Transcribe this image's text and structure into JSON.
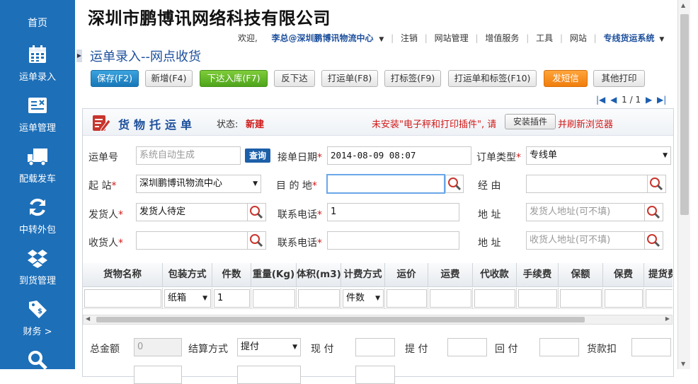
{
  "sidebar": {
    "home": "首页",
    "items": [
      {
        "label": "运单录入",
        "icon": "calendar-icon"
      },
      {
        "label": "运单管理",
        "icon": "ledger-icon"
      },
      {
        "label": "配载发车",
        "icon": "truck-icon"
      },
      {
        "label": "中转外包",
        "icon": "refresh-icon"
      },
      {
        "label": "到货管理",
        "icon": "dropbox-icon"
      },
      {
        "label": "财务 >",
        "icon": "tag-icon"
      },
      {
        "label": "",
        "icon": "search-icon"
      }
    ]
  },
  "header": {
    "company": "深圳市鹏博讯网络科技有限公司",
    "nav": {
      "welcome": "欢迎,",
      "user": "李总@深圳鹏博讯物流中心",
      "logout": "注销",
      "site_admin": "网站管理",
      "value_added": "增值服务",
      "tools": "工具",
      "website": "网站",
      "system": "专线货运系统"
    }
  },
  "page": {
    "title": "运单录入--网点收货"
  },
  "toolbar": {
    "save": "保存(F2)",
    "add": "新增(F4)",
    "stock_in": "下达入库(F7)",
    "revoke": "反下达",
    "print_waybill": "打运单(F8)",
    "print_label": "打标签(F9)",
    "print_both": "打运单和标签(F10)",
    "sms": "发短信",
    "other_print": "其他打印"
  },
  "pager": {
    "text": "1 / 1"
  },
  "form": {
    "title": "货物托运单",
    "status_label": "状态:",
    "status_value": "新建",
    "warning": "未安装\"电子秤和打印插件\", 请",
    "install_button": "安装插件",
    "warning_tail": "并刷新浏览器",
    "waybill_no_label": "运单号",
    "waybill_no_placeholder": "系统自动生成",
    "query_button": "查询",
    "date_label": "接单日期",
    "date_value": "2014-08-09 08:07",
    "type_label": "订单类型",
    "type_value": "专线单",
    "origin_label": "起  站",
    "origin_value": "深圳鹏博讯物流中心",
    "dest_label": "目 的 地",
    "dest_value": "",
    "via_label": "经  由",
    "via_value": "",
    "sender_label": "发货人",
    "sender_value": "发货人待定",
    "sender_phone_label": "联系电话",
    "sender_phone_value": "1",
    "sender_addr_label": "地  址",
    "sender_addr_placeholder": "发货人地址(可不填)",
    "receiver_label": "收货人",
    "receiver_value": "",
    "receiver_phone_label": "联系电话",
    "receiver_phone_value": "",
    "receiver_addr_label": "地  址",
    "receiver_addr_placeholder": "收货人地址(可不填)"
  },
  "grid": {
    "headers": [
      "货物名称",
      "包装方式",
      "件数",
      "重量(Kg)",
      "体积(m3)",
      "计费方式",
      "运价",
      "运费",
      "代收款",
      "手续费",
      "保额",
      "保费",
      "提货费"
    ],
    "row": {
      "name": "",
      "packing": "纸箱",
      "count": "1",
      "billing": "件数"
    }
  },
  "footer": {
    "total_label": "总金额",
    "total_value": "0",
    "settle_label": "结算方式",
    "settle_value": "提付",
    "cash_label": "现  付",
    "pickup_label": "提  付",
    "return_label": "回  付",
    "deduct_label": "货款扣"
  }
}
